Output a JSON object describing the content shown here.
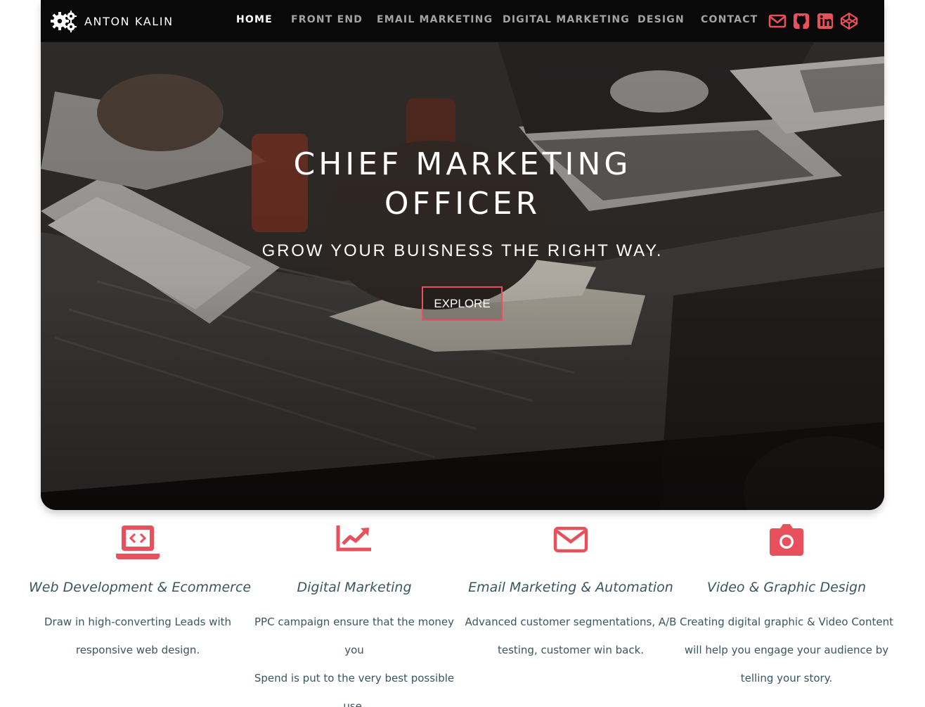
{
  "brand": {
    "name": "ANTON KALIN",
    "logo_icon": "gears-icon"
  },
  "nav": {
    "items": [
      {
        "label": "HOME",
        "active": true
      },
      {
        "label": "FRONT END",
        "active": false
      },
      {
        "label": "EMAIL MARKETING",
        "active": false
      },
      {
        "label": "DIGITAL MARKETING",
        "active": false
      },
      {
        "label": "DESIGN",
        "active": false
      },
      {
        "label": "CONTACT",
        "active": false
      }
    ],
    "social_icons": [
      "email-icon",
      "github-icon",
      "linkedin-icon",
      "codepen-icon"
    ]
  },
  "hero": {
    "title_line1": "CHIEF MARKETING",
    "title_line2": "OFFICER",
    "subtitle": "GROW YOUR BUISNESS THE RIGHT WAY.",
    "button_label": "EXPLORE",
    "background": "office-desk-photo"
  },
  "services": [
    {
      "icon": "laptop-code-icon",
      "title": "Web Development & Ecommerce",
      "lines": [
        "Draw in high-converting Leads with",
        "responsive web design."
      ]
    },
    {
      "icon": "chart-line-icon",
      "title": "Digital Marketing",
      "lines": [
        "PPC campaign ensure that the money you",
        "Spend is put to the very best possible use."
      ]
    },
    {
      "icon": "envelope-icon",
      "title": "Email Marketing & Automation",
      "lines": [
        "Advanced customer segmentations, A/B",
        "testing, customer win back."
      ]
    },
    {
      "icon": "camera-icon",
      "title": "Video & Graphic Design",
      "lines": [
        "Creating digital graphic & Video Content",
        "will help you engage your audience by",
        "telling your story."
      ]
    }
  ],
  "colors": {
    "accent": "#e8505b",
    "text": "#3b5561",
    "nav_bg": "#080808",
    "nav_inactive": "#a3a3a3"
  }
}
